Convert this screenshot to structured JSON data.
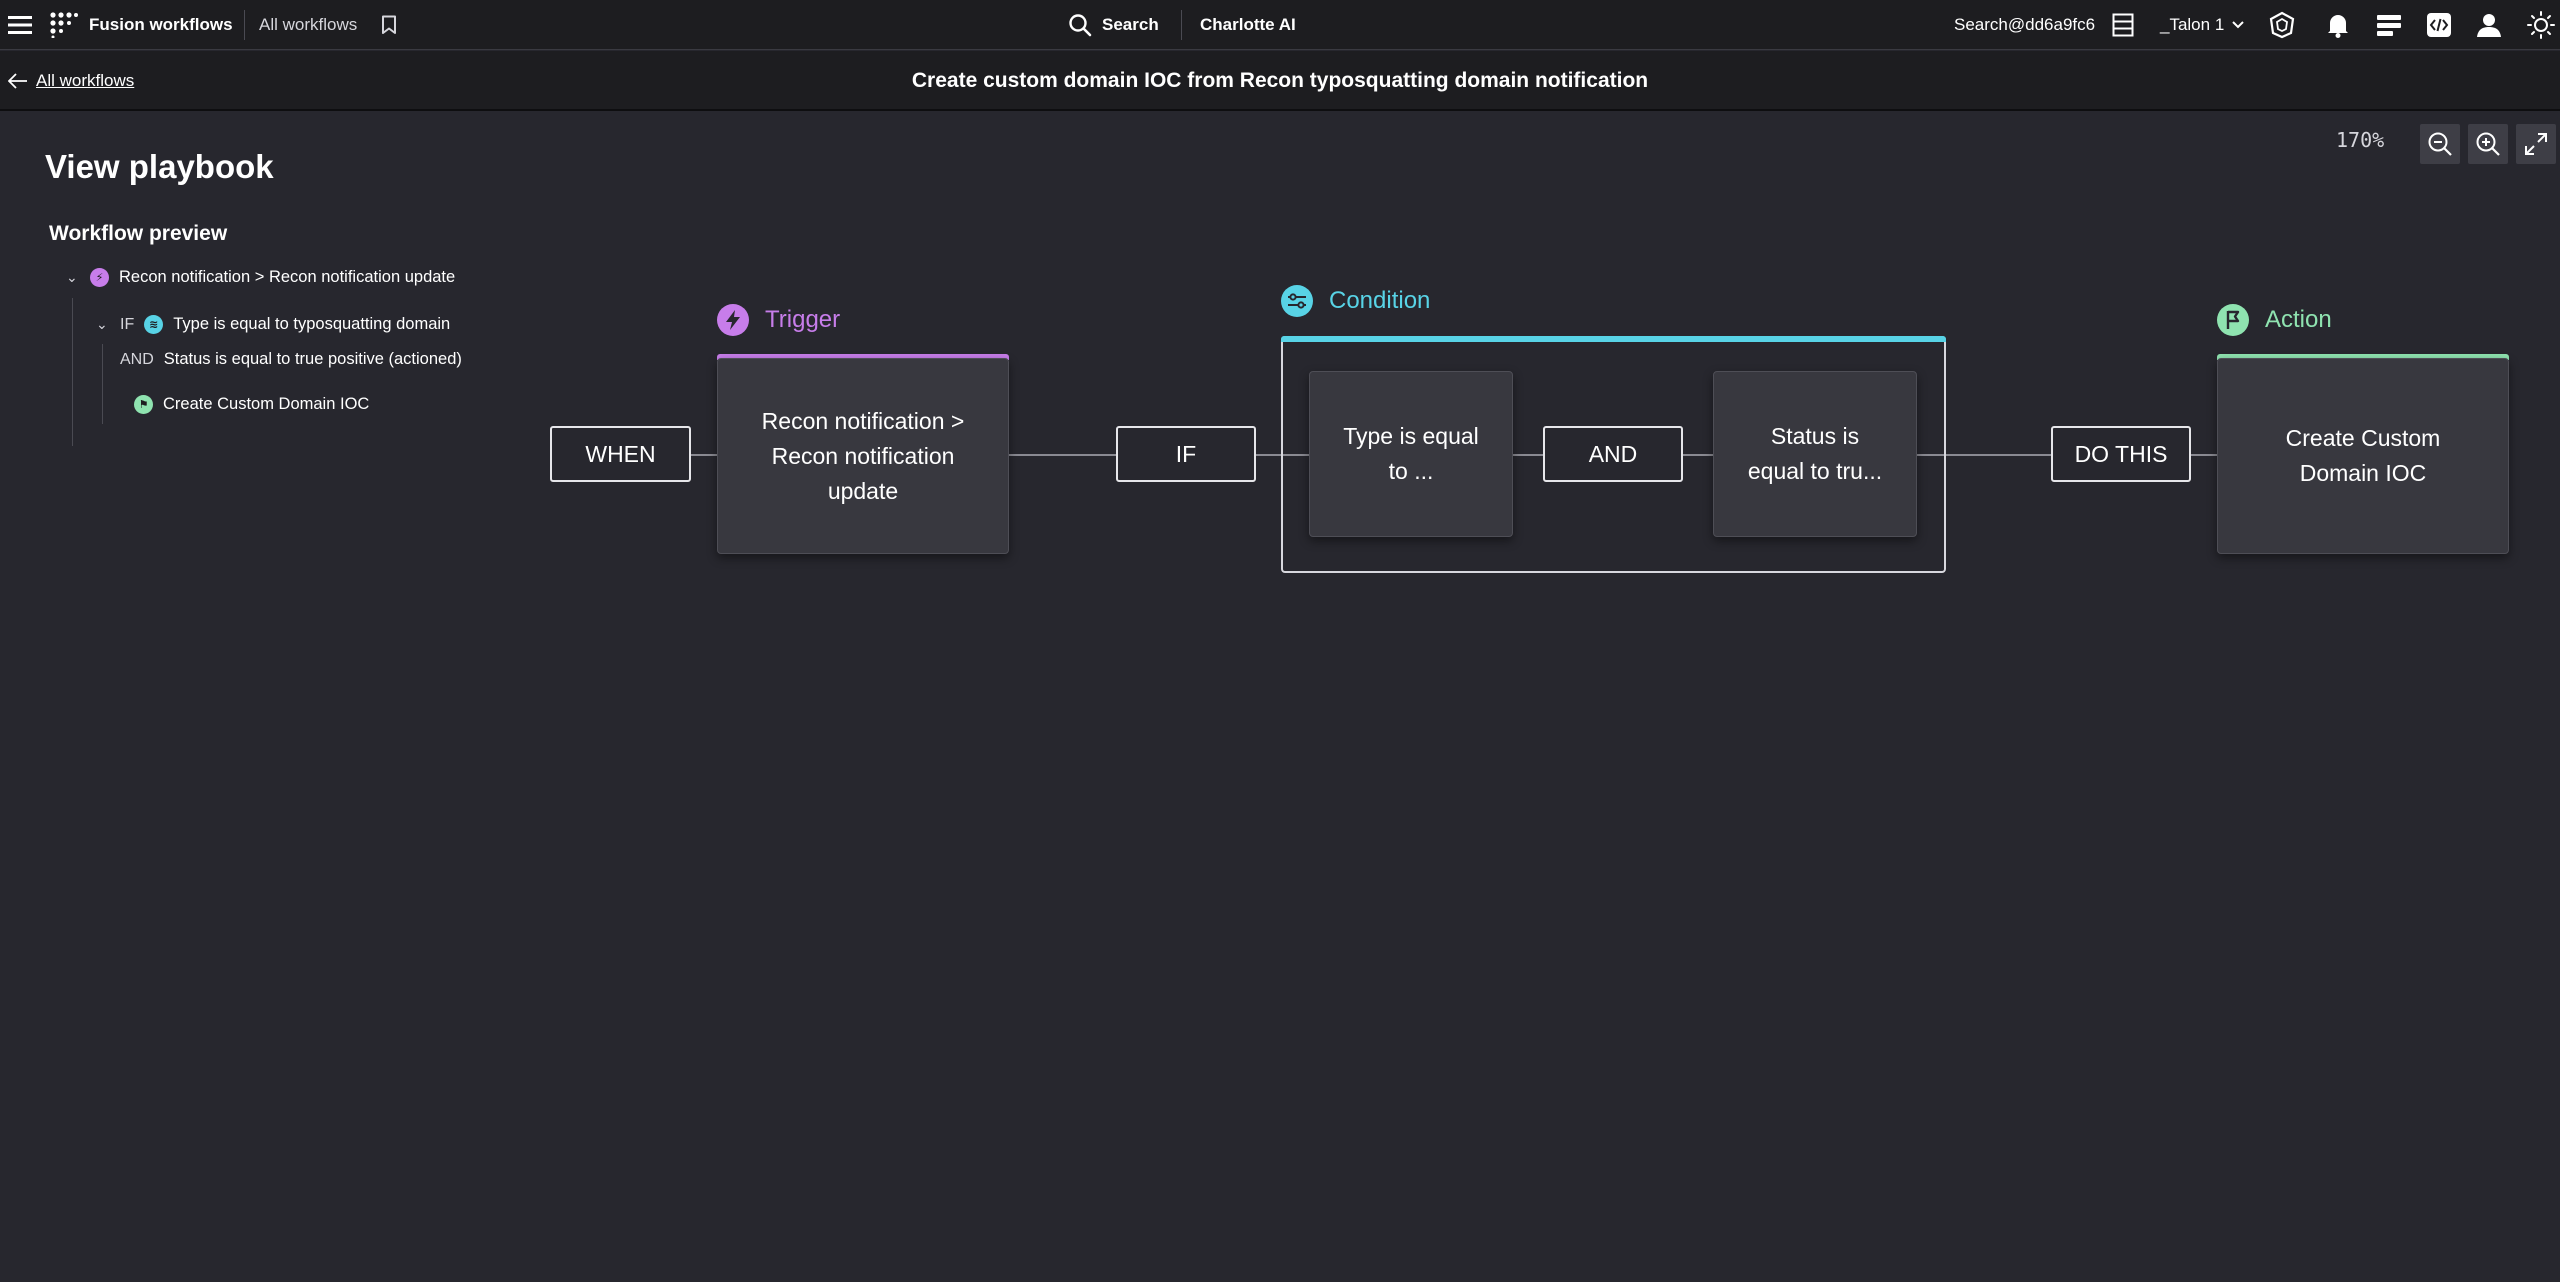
{
  "colors": {
    "trigger": "#c77dea",
    "condition": "#58d3e6",
    "action": "#8fe3b0",
    "background": "#27272e",
    "bar": "#1d1d20"
  },
  "topbar": {
    "menu_icon": "hamburger-icon",
    "app_icon": "fusion-logo-icon",
    "app_name": "Fusion workflows",
    "breadcrumb": "All workflows",
    "bookmark_icon": "bookmark-icon",
    "search_label": "Search",
    "charlotte_label": "Charlotte AI",
    "account_search": "Search@dd6a9fc6",
    "tenant": "_Talon 1"
  },
  "subheader": {
    "back_label": "All workflows",
    "title": "Create custom domain IOC from Recon typosquatting domain notification"
  },
  "left_panel": {
    "title": "View playbook",
    "preview_title": "Workflow preview",
    "tree": {
      "trigger": "Recon notification > Recon notification update",
      "if_keyword": "IF",
      "condition_1": "Type is equal to typosquatting domain",
      "and_keyword": "AND",
      "condition_2": "Status is equal to true positive (actioned)",
      "action": "Create Custom Domain IOC"
    }
  },
  "zoom": {
    "level": "170%"
  },
  "canvas": {
    "trigger_label": "Trigger",
    "condition_label": "Condition",
    "action_label": "Action",
    "when": "WHEN",
    "if": "IF",
    "and": "AND",
    "do_this": "DO THIS",
    "trigger_node": "Recon notification >\nRecon notification\nupdate",
    "condition_node_1": "Type is equal\nto ...",
    "condition_node_2": "Status is\nequal to tru...",
    "action_node": "Create Custom\nDomain IOC"
  }
}
